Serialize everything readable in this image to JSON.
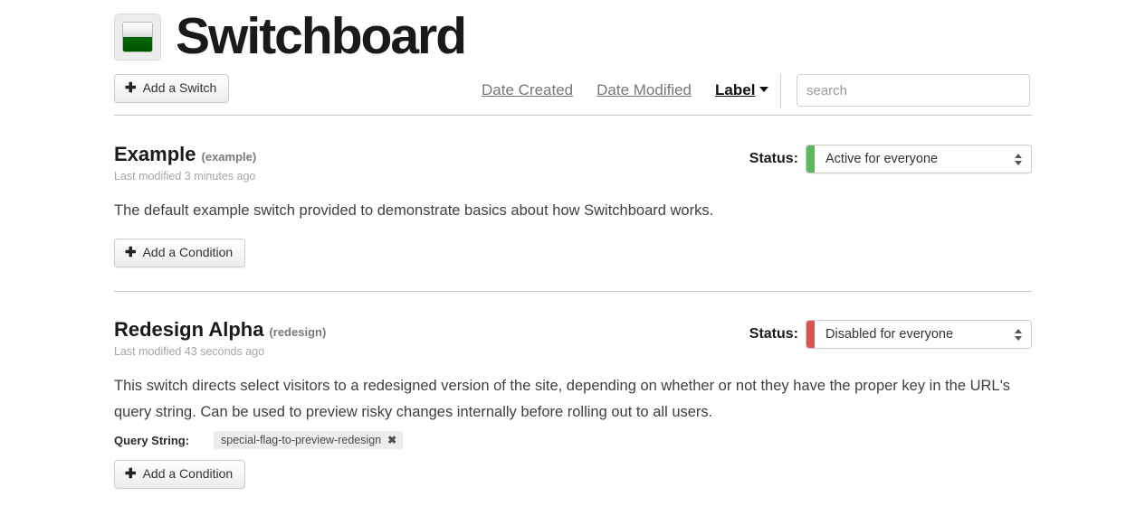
{
  "app": {
    "title": "Switchboard",
    "logo_icon": "switch-toggle-icon"
  },
  "toolbar": {
    "add_switch_label": "Add a Switch",
    "add_switch_icon": "plus-icon",
    "sorts": [
      {
        "label": "Date Created",
        "active": false
      },
      {
        "label": "Date Modified",
        "active": false
      },
      {
        "label": "Label",
        "active": true,
        "caret_icon": "caret-down-icon"
      }
    ],
    "search": {
      "placeholder": "search",
      "value": ""
    }
  },
  "status_colors": {
    "active": "#5cb85c",
    "disabled": "#d9534f"
  },
  "switches": [
    {
      "name": "Example",
      "key": "(example)",
      "modified": "Last modified 3 minutes ago",
      "status_label": "Status:",
      "status_value": "Active for everyone",
      "status_color": "#5cb85c",
      "description": "The default example switch provided to demonstrate basics about how Switchboard works.",
      "add_condition_label": "Add a Condition",
      "conditions": []
    },
    {
      "name": "Redesign Alpha",
      "key": "(redesign)",
      "modified": "Last modified 43 seconds ago",
      "status_label": "Status:",
      "status_value": "Disabled for everyone",
      "status_color": "#d9534f",
      "description": "This switch directs select visitors to a redesigned version of the site, depending on whether or not they have the proper key in the URL's query string. Can be used to preview risky changes internally before rolling out to all users.",
      "add_condition_label": "Add a Condition",
      "conditions": [
        {
          "label": "Query String:",
          "value": "special-flag-to-preview-redesign",
          "remove_icon": "✖"
        }
      ]
    }
  ]
}
